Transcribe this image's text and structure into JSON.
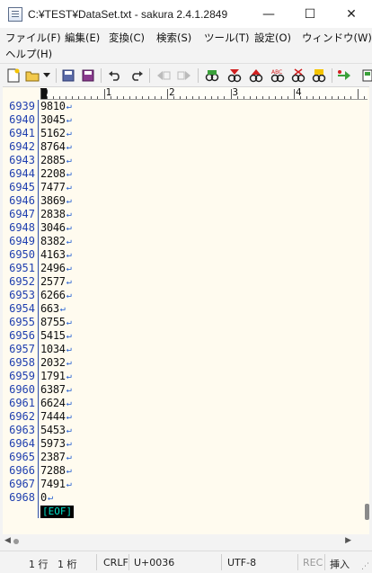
{
  "window": {
    "title": "C:¥TEST¥DataSet.txt - sakura 2.4.1.2849",
    "minimize": "—",
    "maximize": "☐",
    "close": "✕"
  },
  "menu": [
    "ファイル(F)",
    "編集(E)",
    "変換(C)",
    "検索(S)",
    "ツール(T)",
    "設定(O)",
    "ウィンドウ(W)",
    "ヘルプ(H)"
  ],
  "toolbar": {
    "icons": [
      "new-file-icon",
      "open-folder-icon",
      "dropdown-icon",
      "save-icon",
      "save-all-icon",
      "undo-icon",
      "redo-icon",
      "jump-back-icon",
      "jump-forward-icon",
      "find-icon",
      "find-next-down-icon",
      "find-next-up-icon",
      "replace-icon",
      "clear-highlight-icon",
      "grep-icon",
      "tag-jump-icon",
      "outline-icon"
    ]
  },
  "ruler": {
    "labels": [
      "0",
      "1",
      "2",
      "3",
      "4"
    ]
  },
  "editor": {
    "lines": [
      {
        "num": "6939",
        "text": "9810"
      },
      {
        "num": "6940",
        "text": "3045"
      },
      {
        "num": "6941",
        "text": "5162"
      },
      {
        "num": "6942",
        "text": "8764"
      },
      {
        "num": "6943",
        "text": "2885"
      },
      {
        "num": "6944",
        "text": "2208"
      },
      {
        "num": "6945",
        "text": "7477"
      },
      {
        "num": "6946",
        "text": "3869"
      },
      {
        "num": "6947",
        "text": "2838"
      },
      {
        "num": "6948",
        "text": "3046"
      },
      {
        "num": "6949",
        "text": "8382"
      },
      {
        "num": "6950",
        "text": "4163"
      },
      {
        "num": "6951",
        "text": "2496"
      },
      {
        "num": "6952",
        "text": "2577"
      },
      {
        "num": "6953",
        "text": "6266"
      },
      {
        "num": "6954",
        "text": "663"
      },
      {
        "num": "6955",
        "text": "8755"
      },
      {
        "num": "6956",
        "text": "5415"
      },
      {
        "num": "6957",
        "text": "1034"
      },
      {
        "num": "6958",
        "text": "2032"
      },
      {
        "num": "6959",
        "text": "1791"
      },
      {
        "num": "6960",
        "text": "6387"
      },
      {
        "num": "6961",
        "text": "6624"
      },
      {
        "num": "6962",
        "text": "7444"
      },
      {
        "num": "6963",
        "text": "5453"
      },
      {
        "num": "6964",
        "text": "5973"
      },
      {
        "num": "6965",
        "text": "2387"
      },
      {
        "num": "6966",
        "text": "7288"
      },
      {
        "num": "6967",
        "text": "7491"
      },
      {
        "num": "6968",
        "text": "0"
      }
    ],
    "crlf_mark": "↵",
    "eof_label": "[EOF]"
  },
  "status": {
    "line": "1 行",
    "column": "1 桁",
    "eol": "CRLF",
    "codepoint": "U+0036",
    "encoding": "UTF-8",
    "rec": "REC",
    "insert": "挿入"
  }
}
